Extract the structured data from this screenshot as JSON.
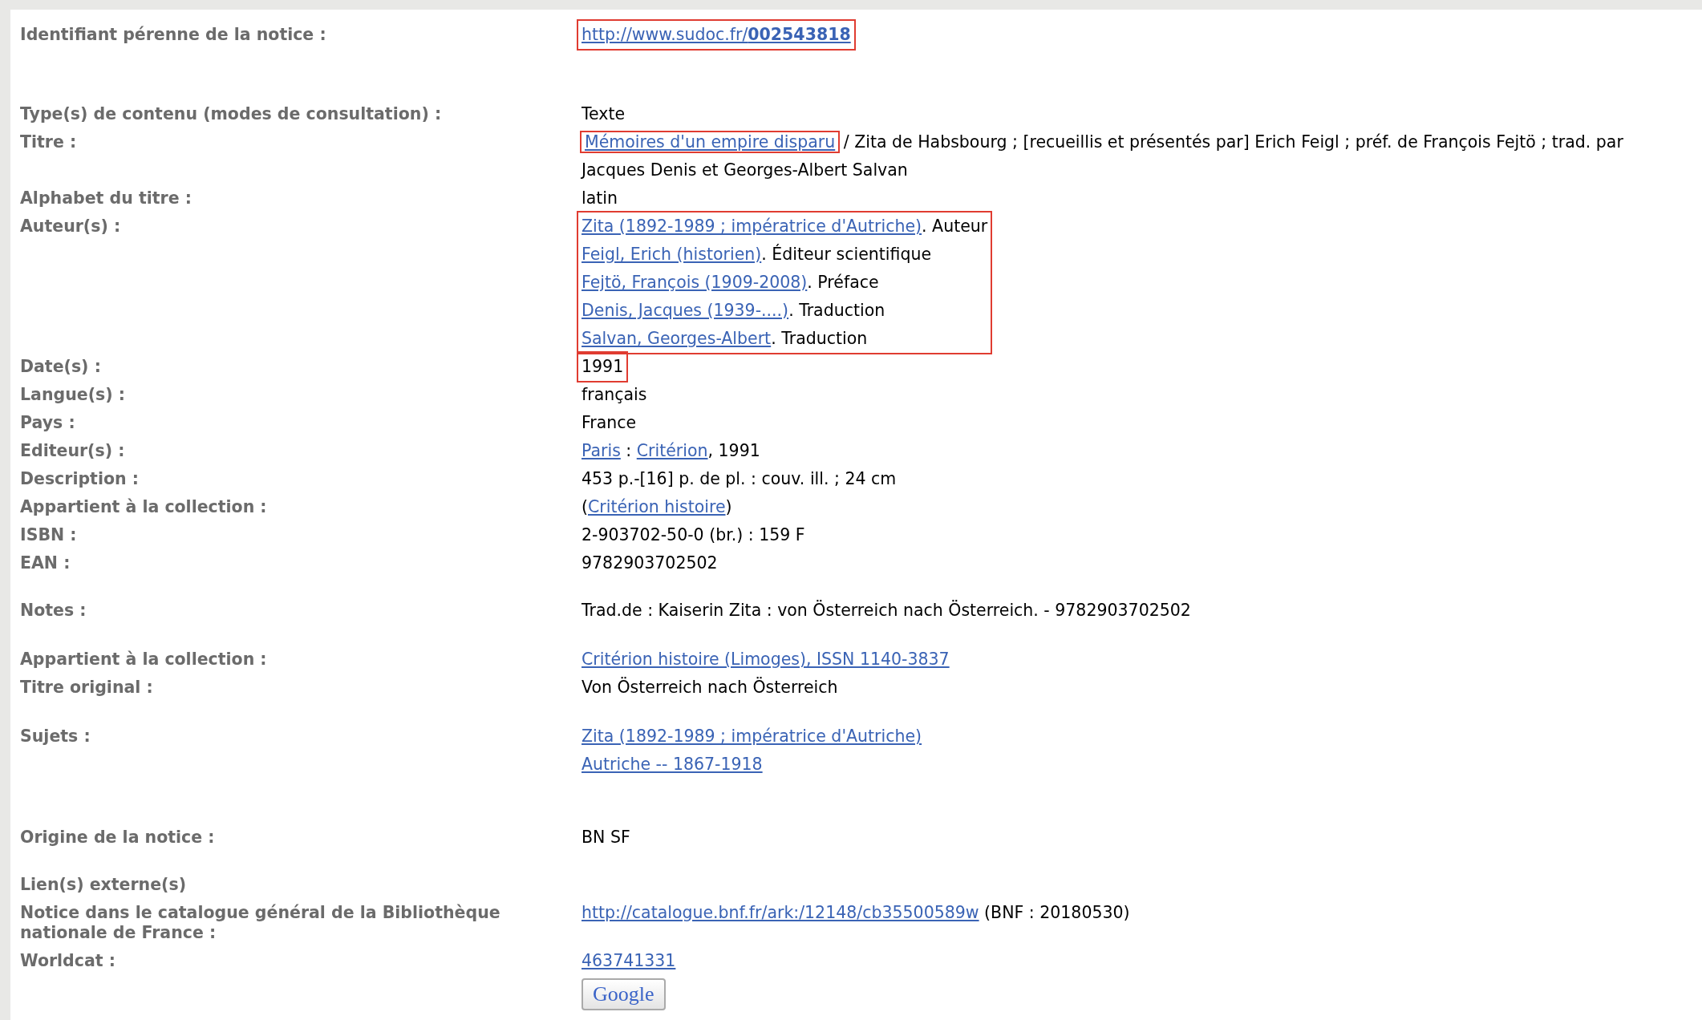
{
  "groups": [
    {
      "rows": [
        {
          "label": "Identifiant pérenne de la notice :",
          "highlighted": true,
          "lines": [
            [
              {
                "kind": "link",
                "text": "http://www.sudoc.fr/**002543818**"
              }
            ]
          ]
        }
      ]
    },
    {
      "rows": [
        {
          "label": "Type(s) de contenu (modes de consultation) :",
          "highlighted": false,
          "lines": [
            [
              {
                "kind": "text",
                "text": "Texte"
              }
            ]
          ]
        },
        {
          "label": "Titre :",
          "highlighted": false,
          "lines": [
            [
              {
                "kind": "link",
                "text": "Mémoires d'un empire disparu",
                "highlighted": true
              },
              {
                "kind": "text",
                "text": " / Zita de Habsbourg ; [recueillis et présentés par] Erich Feigl ; préf. de François Fejtö ; trad. par",
                "highlighted": false
              }
            ],
            [
              {
                "kind": "text",
                "text": "Jacques Denis et Georges-Albert Salvan"
              }
            ]
          ]
        },
        {
          "label": "Alphabet du titre :",
          "highlighted": false,
          "lines": [
            [
              {
                "kind": "text",
                "text": "latin"
              }
            ]
          ]
        },
        {
          "label": "Auteur(s) :",
          "highlighted": true,
          "lines": [
            [
              {
                "kind": "link",
                "text": "Zita (1892-1989 ; impératrice d'Autriche)"
              },
              {
                "kind": "text",
                "text": ". Auteur"
              }
            ],
            [
              {
                "kind": "link",
                "text": "Feigl, Erich (historien)"
              },
              {
                "kind": "text",
                "text": ". Éditeur scientifique"
              }
            ],
            [
              {
                "kind": "link",
                "text": "Fejtö, François (1909-2008)"
              },
              {
                "kind": "text",
                "text": ". Préface"
              }
            ],
            [
              {
                "kind": "link",
                "text": "Denis, Jacques (1939-....)"
              },
              {
                "kind": "text",
                "text": ". Traduction"
              }
            ],
            [
              {
                "kind": "link",
                "text": "Salvan, Georges-Albert"
              },
              {
                "kind": "text",
                "text": ". Traduction"
              }
            ]
          ]
        },
        {
          "label": "Date(s) :",
          "highlighted": true,
          "lines": [
            [
              {
                "kind": "text",
                "text": "1991"
              }
            ]
          ]
        },
        {
          "label": "Langue(s) :",
          "highlighted": false,
          "lines": [
            [
              {
                "kind": "text",
                "text": "français"
              }
            ]
          ]
        },
        {
          "label": "Pays :",
          "highlighted": false,
          "lines": [
            [
              {
                "kind": "text",
                "text": "France"
              }
            ]
          ]
        },
        {
          "label": "Editeur(s) :",
          "highlighted": false,
          "lines": [
            [
              {
                "kind": "link",
                "text": "Paris"
              },
              {
                "kind": "text",
                "text": " : "
              },
              {
                "kind": "link",
                "text": "Critérion"
              },
              {
                "kind": "text",
                "text": ", 1991"
              }
            ]
          ]
        },
        {
          "label": "Description :",
          "highlighted": false,
          "lines": [
            [
              {
                "kind": "text",
                "text": "453 p.-[16] p. de pl. : couv. ill. ; 24 cm"
              }
            ]
          ]
        },
        {
          "label": "Appartient à la collection :",
          "highlighted": false,
          "lines": [
            [
              {
                "kind": "text",
                "text": "("
              },
              {
                "kind": "link",
                "text": "Critérion histoire"
              },
              {
                "kind": "text",
                "text": ")"
              }
            ]
          ]
        },
        {
          "label": "ISBN :",
          "highlighted": false,
          "lines": [
            [
              {
                "kind": "text",
                "text": "2-903702-50-0 (br.) : 159 F"
              }
            ]
          ]
        },
        {
          "label": "EAN :",
          "highlighted": false,
          "lines": [
            [
              {
                "kind": "text",
                "text": "9782903702502"
              }
            ]
          ]
        }
      ]
    },
    {
      "rows": [
        {
          "label": "Notes :",
          "highlighted": false,
          "lines": [
            [
              {
                "kind": "text",
                "text": "Trad.de : Kaiserin Zita : von Österreich nach Österreich. - 9782903702502"
              }
            ]
          ]
        }
      ]
    },
    {
      "rows": [
        {
          "label": "Appartient à la collection :",
          "highlighted": false,
          "lines": [
            [
              {
                "kind": "link",
                "text": "Critérion histoire (Limoges), ISSN 1140-3837"
              }
            ]
          ]
        },
        {
          "label": "Titre original :",
          "highlighted": false,
          "lines": [
            [
              {
                "kind": "text",
                "text": "Von Österreich nach Österreich"
              }
            ]
          ]
        }
      ]
    },
    {
      "rows": [
        {
          "label": "Sujets :",
          "highlighted": false,
          "lines": [
            [
              {
                "kind": "link",
                "text": "Zita (1892-1989 ; impératrice d'Autriche)"
              }
            ],
            [
              {
                "kind": "link",
                "text": "Autriche -- 1867-1918"
              }
            ]
          ]
        }
      ]
    },
    {
      "rows": [
        {
          "label": "Origine de la notice :",
          "highlighted": false,
          "lines": [
            [
              {
                "kind": "text",
                "text": "BN SF"
              }
            ]
          ]
        }
      ]
    },
    {
      "rows": [
        {
          "label": "Lien(s) externe(s)",
          "highlighted": false,
          "lines": []
        },
        {
          "label": "Notice dans le catalogue général de la Bibliothèque nationale de France :",
          "highlighted": false,
          "lines": [
            [
              {
                "kind": "link",
                "text": "http://catalogue.bnf.fr/ark:/12148/cb35500589w"
              },
              {
                "kind": "text",
                "text": " (BNF : 20180530)"
              }
            ]
          ]
        },
        {
          "label": "Worldcat :",
          "highlighted": false,
          "lines": [
            [
              {
                "kind": "link",
                "text": "463741331"
              }
            ],
            [
              {
                "kind": "button",
                "text": "Google"
              }
            ]
          ]
        }
      ]
    }
  ]
}
